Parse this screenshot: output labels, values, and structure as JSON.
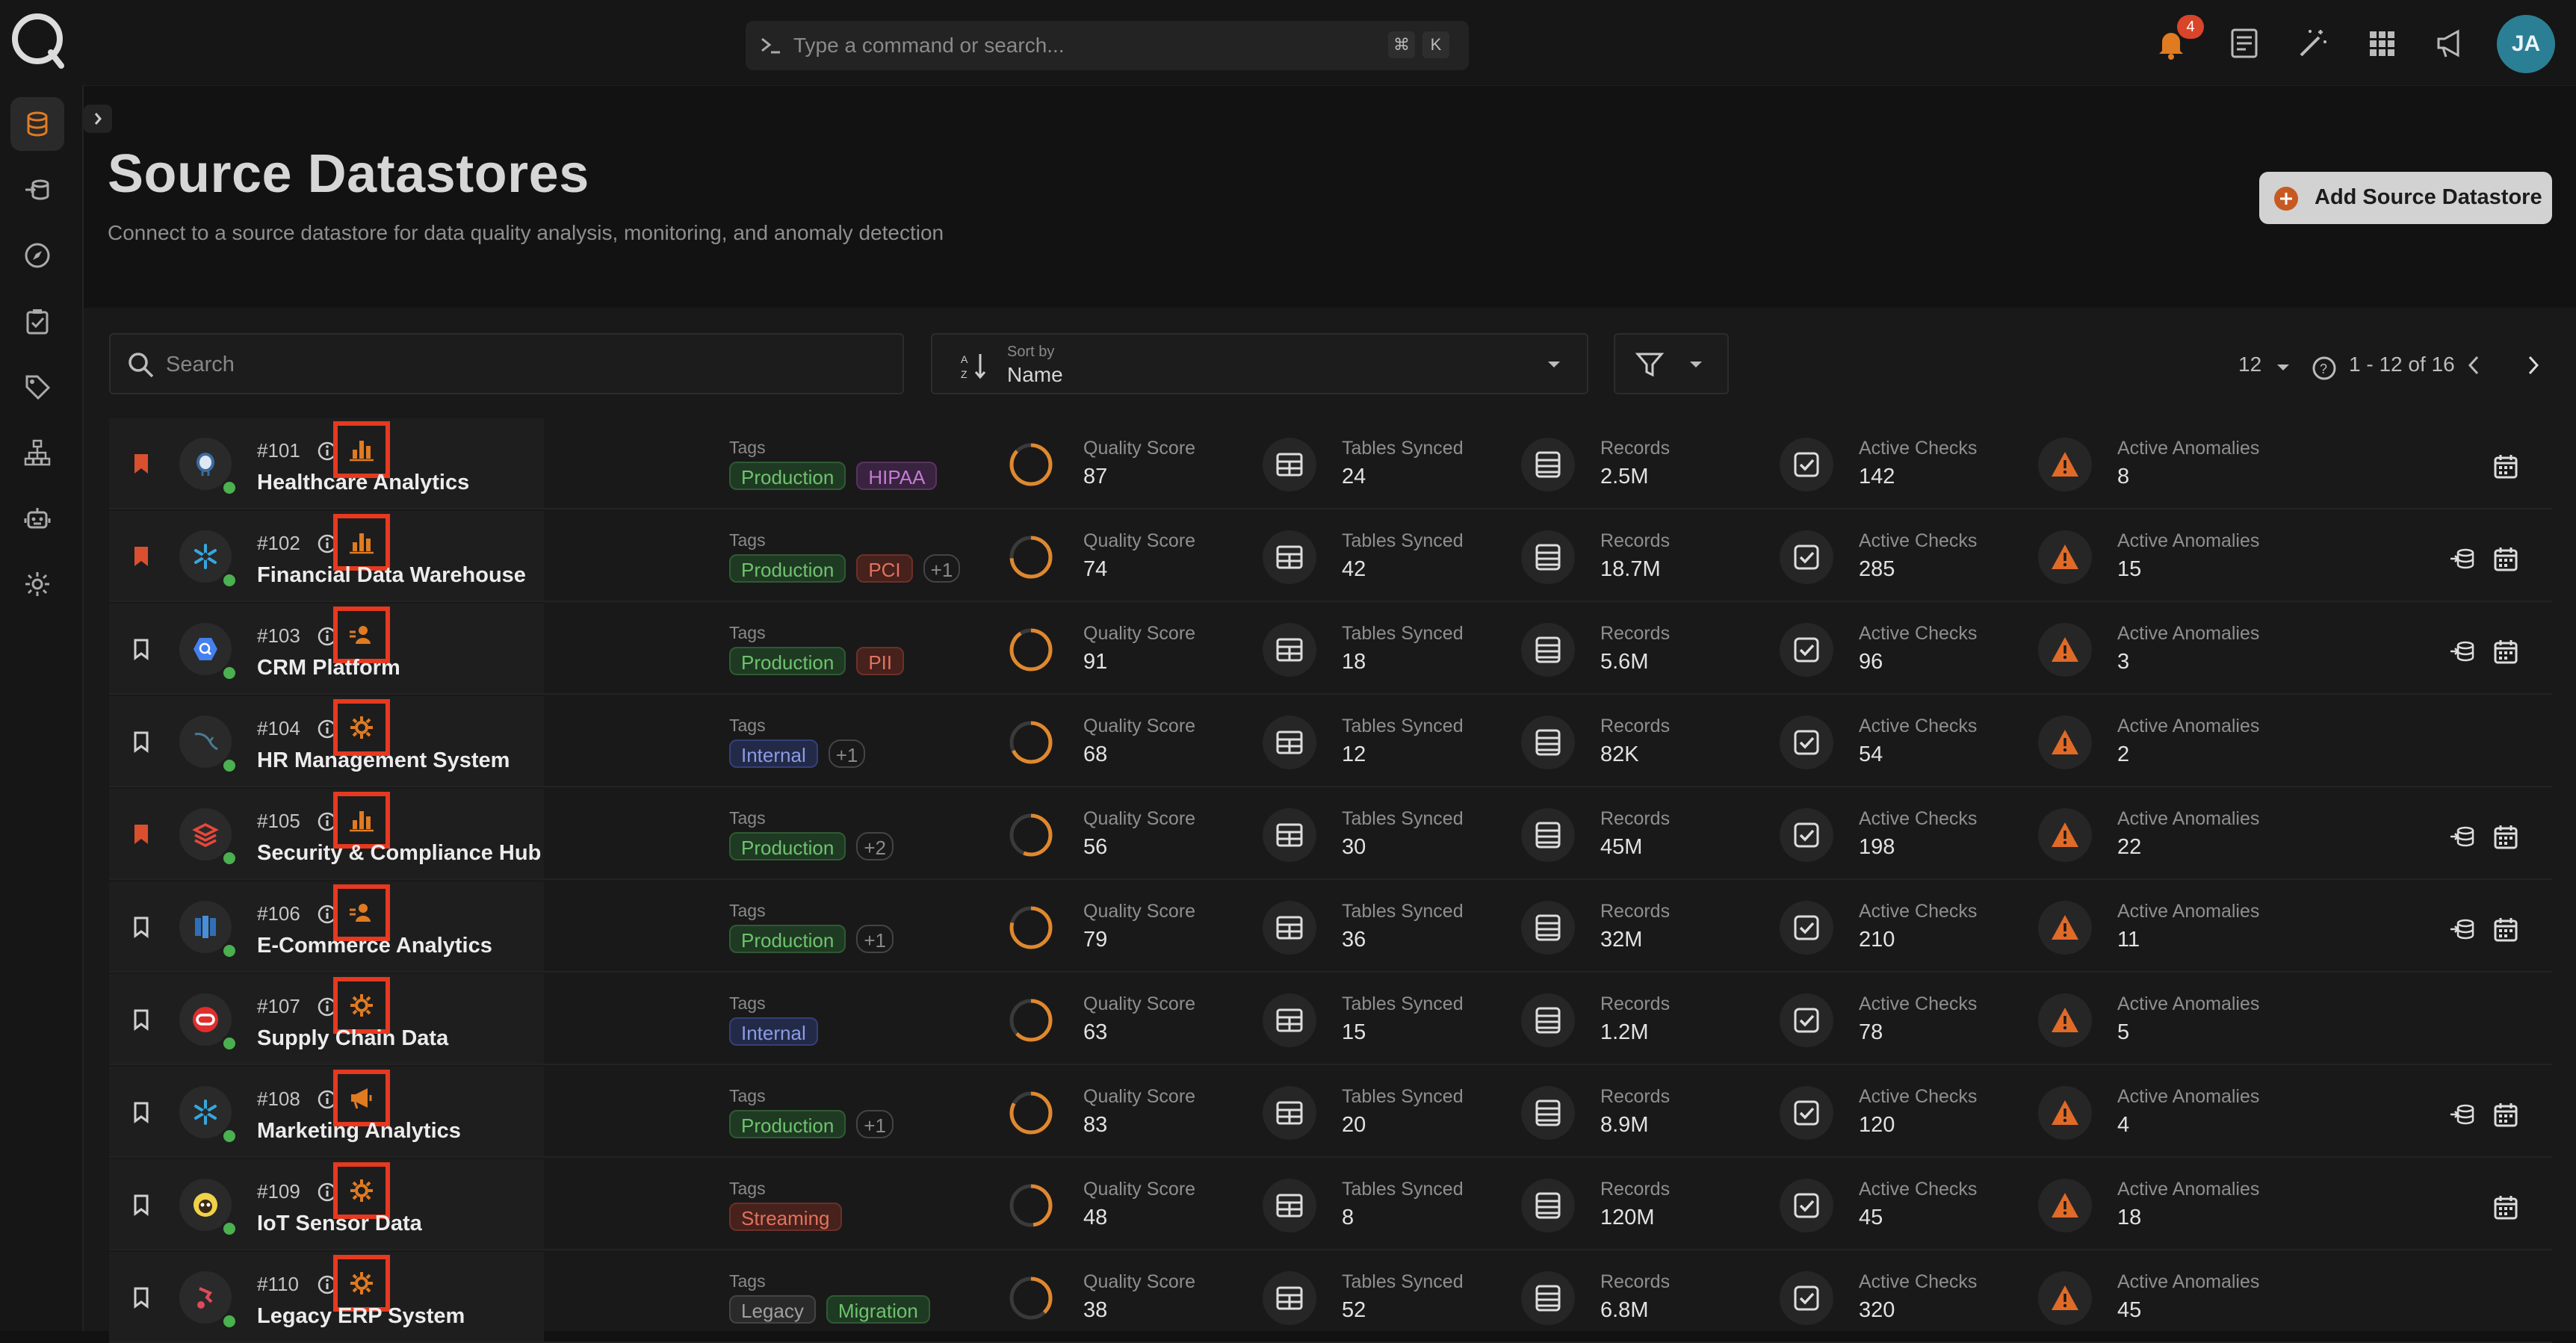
{
  "topbar": {
    "command_placeholder": "Type a command or search...",
    "shortcut_keys": [
      "⌘",
      "K"
    ],
    "notification_count": "4",
    "user_initials": "JA",
    "icons": [
      "bell-icon",
      "document-icon",
      "magic-wand-icon",
      "apps-grid-icon",
      "megaphone-icon"
    ]
  },
  "sidebar": {
    "items": [
      "datastores-icon",
      "flows-icon",
      "explore-icon",
      "checks-icon",
      "tags-icon",
      "hierarchy-icon",
      "robot-icon",
      "settings-icon"
    ],
    "active": 0
  },
  "header": {
    "title": "Source Datastores",
    "subtitle": "Connect to a source datastore for data quality analysis, monitoring, and anomaly detection",
    "add_button": "Add Source Datastore"
  },
  "toolbar": {
    "search_placeholder": "Search",
    "sort_caption": "Sort by",
    "sort_value": "Name",
    "per_page": "12",
    "range": "1 - 12 of 16"
  },
  "labels": {
    "tags": "Tags",
    "quality_score": "Quality Score",
    "tables_synced": "Tables Synced",
    "records": "Records",
    "active_checks": "Active Checks",
    "active_anomalies": "Active Anomalies"
  },
  "colors": {
    "accent": "#e6391f",
    "brand_orange": "#c65a22",
    "status_ok": "#4bb04f"
  },
  "datastores": [
    {
      "id": "#101",
      "name": "Healthcare Analytics",
      "bookmarked": true,
      "logo": "postgres-icon",
      "type_icon": "chart-icon",
      "tags": [
        {
          "t": "Production",
          "c": "green"
        },
        {
          "t": "HIPAA",
          "c": "purple"
        }
      ],
      "quality": 87,
      "tables": "24",
      "records": "2.5M",
      "checks": "142",
      "anomalies": "8",
      "actions": [
        "calendar-icon"
      ]
    },
    {
      "id": "#102",
      "name": "Financial Data Warehouse",
      "bookmarked": true,
      "logo": "snowflake-icon",
      "type_icon": "chart-icon",
      "tags": [
        {
          "t": "Production",
          "c": "green"
        },
        {
          "t": "PCI",
          "c": "red"
        },
        {
          "t": "+1",
          "c": "more"
        }
      ],
      "quality": 74,
      "tables": "42",
      "records": "18.7M",
      "checks": "285",
      "anomalies": "15",
      "actions": [
        "sync-icon",
        "calendar-icon"
      ]
    },
    {
      "id": "#103",
      "name": "CRM Platform",
      "bookmarked": false,
      "logo": "bigquery-icon",
      "type_icon": "user-card-icon",
      "tags": [
        {
          "t": "Production",
          "c": "green"
        },
        {
          "t": "PII",
          "c": "red"
        }
      ],
      "quality": 91,
      "tables": "18",
      "records": "5.6M",
      "checks": "96",
      "anomalies": "3",
      "actions": [
        "sync-icon",
        "calendar-icon"
      ]
    },
    {
      "id": "#104",
      "name": "HR Management System",
      "bookmarked": false,
      "logo": "mysql-icon",
      "type_icon": "gear-icon",
      "tags": [
        {
          "t": "Internal",
          "c": "blue"
        },
        {
          "t": "+1",
          "c": "more"
        }
      ],
      "quality": 68,
      "tables": "12",
      "records": "82K",
      "checks": "54",
      "anomalies": "2",
      "actions": []
    },
    {
      "id": "#105",
      "name": "Security & Compliance Hub",
      "bookmarked": true,
      "logo": "databricks-icon",
      "type_icon": "chart-icon",
      "tags": [
        {
          "t": "Production",
          "c": "green"
        },
        {
          "t": "+2",
          "c": "more"
        }
      ],
      "quality": 56,
      "tables": "30",
      "records": "45M",
      "checks": "198",
      "anomalies": "22",
      "actions": [
        "sync-icon",
        "calendar-icon"
      ]
    },
    {
      "id": "#106",
      "name": "E-Commerce Analytics",
      "bookmarked": false,
      "logo": "redshift-icon",
      "type_icon": "user-card-icon",
      "tags": [
        {
          "t": "Production",
          "c": "green"
        },
        {
          "t": "+1",
          "c": "more"
        }
      ],
      "quality": 79,
      "tables": "36",
      "records": "32M",
      "checks": "210",
      "anomalies": "11",
      "actions": [
        "sync-icon",
        "calendar-icon"
      ]
    },
    {
      "id": "#107",
      "name": "Supply Chain Data",
      "bookmarked": false,
      "logo": "oracle-icon",
      "type_icon": "gear-icon",
      "tags": [
        {
          "t": "Internal",
          "c": "blue"
        }
      ],
      "quality": 63,
      "tables": "15",
      "records": "1.2M",
      "checks": "78",
      "anomalies": "5",
      "actions": []
    },
    {
      "id": "#108",
      "name": "Marketing Analytics",
      "bookmarked": false,
      "logo": "snowflake-icon",
      "type_icon": "megaphone-icon",
      "tags": [
        {
          "t": "Production",
          "c": "green"
        },
        {
          "t": "+1",
          "c": "more"
        }
      ],
      "quality": 83,
      "tables": "20",
      "records": "8.9M",
      "checks": "120",
      "anomalies": "4",
      "actions": [
        "sync-icon",
        "calendar-icon"
      ]
    },
    {
      "id": "#109",
      "name": "IoT Sensor Data",
      "bookmarked": false,
      "logo": "hive-icon",
      "type_icon": "gear-icon",
      "tags": [
        {
          "t": "Streaming",
          "c": "red"
        }
      ],
      "quality": 48,
      "tables": "8",
      "records": "120M",
      "checks": "45",
      "anomalies": "18",
      "actions": [
        "calendar-icon"
      ]
    },
    {
      "id": "#110",
      "name": "Legacy ERP System",
      "bookmarked": false,
      "logo": "db2-icon",
      "type_icon": "gear-icon",
      "tags": [
        {
          "t": "Legacy",
          "c": "gray"
        },
        {
          "t": "Migration",
          "c": "green"
        }
      ],
      "quality": 38,
      "tables": "52",
      "records": "6.8M",
      "checks": "320",
      "anomalies": "45",
      "actions": []
    }
  ]
}
